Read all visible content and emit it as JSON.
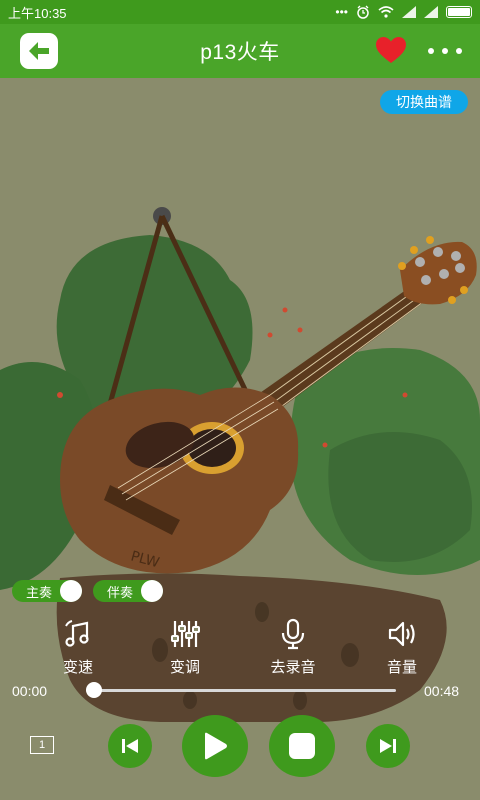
{
  "status_bar": {
    "time": "上午10:35",
    "dots": "•••"
  },
  "header": {
    "title": "p13火车"
  },
  "switch_score_label": "切换曲谱",
  "toggles": [
    {
      "label": "主奏",
      "on": true
    },
    {
      "label": "伴奏",
      "on": true
    }
  ],
  "functions": [
    {
      "label": "变速",
      "icon": "music-note-icon"
    },
    {
      "label": "变调",
      "icon": "sliders-icon"
    },
    {
      "label": "去录音",
      "icon": "microphone-icon"
    },
    {
      "label": "音量",
      "icon": "volume-icon"
    }
  ],
  "player": {
    "current_time": "00:00",
    "total_time": "00:48",
    "progress": 0.0
  },
  "screen_button_label": "1",
  "colors": {
    "status_bar": "#3f9a1d",
    "header": "#4aa529",
    "button_green": "#3f9a1d",
    "switch_blue": "#0fa6e8",
    "heart_red": "#e8212a",
    "background": "#8a8c6c"
  },
  "illustration_text": "PLW"
}
